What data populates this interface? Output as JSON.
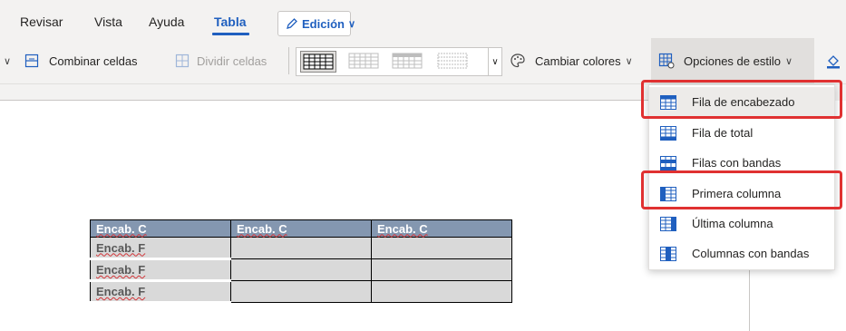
{
  "tabs": [
    {
      "label": "Revisar"
    },
    {
      "label": "Vista"
    },
    {
      "label": "Ayuda"
    },
    {
      "label": "Tabla",
      "active": true
    }
  ],
  "edit_mode": {
    "label": "Edición"
  },
  "ribbon": {
    "merge_cells": "Combinar celdas",
    "split_cells": "Dividir celdas",
    "change_colors": "Cambiar colores",
    "style_options": "Opciones de estilo"
  },
  "style_menu": {
    "items": [
      {
        "label": "Fila de encabezado",
        "icon": "table-header-row-icon"
      },
      {
        "label": "Fila de total",
        "icon": "table-total-row-icon"
      },
      {
        "label": "Filas con bandas",
        "icon": "table-banded-rows-icon"
      },
      {
        "label": "Primera columna",
        "icon": "table-first-column-icon"
      },
      {
        "label": "Última columna",
        "icon": "table-last-column-icon"
      },
      {
        "label": "Columnas con bandas",
        "icon": "table-banded-columns-icon"
      }
    ]
  },
  "table": {
    "header": [
      "Encab. C",
      "Encab. C",
      "Encab. C"
    ],
    "rows": [
      [
        "Encab. F",
        "",
        ""
      ],
      [
        "Encab. F",
        "",
        ""
      ],
      [
        "Encab. F",
        "",
        ""
      ]
    ]
  },
  "colors": {
    "accent": "#1f5fbf",
    "highlight": "#e03131",
    "table_header": "#8497b0",
    "table_body": "#d9d9d9"
  }
}
